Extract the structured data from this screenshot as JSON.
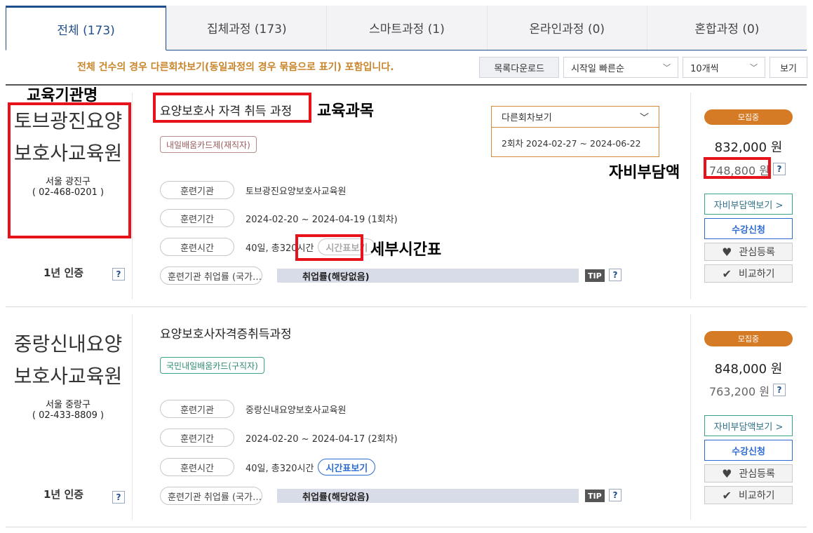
{
  "tabs": [
    {
      "label": "전체 (173)",
      "active": true
    },
    {
      "label": "집체과정 (173)",
      "active": false
    },
    {
      "label": "스마트과정 (1)",
      "active": false
    },
    {
      "label": "온라인과정 (0)",
      "active": false
    },
    {
      "label": "혼합과정 (0)",
      "active": false
    }
  ],
  "notice": "전체 건수의 경우 다른회차보기(동일과정의 경우 묶음으로 표기) 포함입니다.",
  "toolbar": {
    "download_label": "목록다운로드",
    "sort_selected": "시작일 빠른순",
    "count_selected": "10개씩",
    "view_label": "보기"
  },
  "courses": [
    {
      "institution": "토브광진요양보호사교육원",
      "location": "서울 광진구",
      "phone": "( 02-468-0201 )",
      "cert": "1년 인증",
      "title": "요양보호사 자격 취득 과정",
      "tag": "내일배움카드제(재직자)",
      "rows": {
        "org_label": "훈련기관",
        "org_value": "토브광진요양보호사교육원",
        "period_label": "훈련기간",
        "period_value": "2024-02-20 ~ 2024-04-19 (1회차)",
        "hours_label": "훈련시간",
        "hours_value": "40일, 총320시간",
        "timetable_label": "시간표보기",
        "job_label": "훈련기관 취업률 (국가…",
        "job_value": "취업률(해당없음)",
        "tip": "TIP"
      },
      "other_sessions": {
        "header": "다른회차보기",
        "option": "2회차 2024-02-27 ~ 2024-06-22"
      },
      "status": "모집중",
      "price": "832,000 원",
      "self_pay": "748,800 원",
      "actions": {
        "self_pay_view": "자비부담액보기 >",
        "apply": "수강신청",
        "favorite": "관심등록",
        "compare": "비교하기"
      }
    },
    {
      "institution": "중랑신내요양보호사교육원",
      "location": "서울 중랑구",
      "phone": "( 02-433-8809 )",
      "cert": "1년 인증",
      "title": "요양보호사자격증취득과정",
      "tag": "국민내일배움카드(구직자)",
      "rows": {
        "org_label": "훈련기관",
        "org_value": "중랑신내요양보호사교육원",
        "period_label": "훈련기간",
        "period_value": "2024-02-20 ~ 2024-04-17 (2회차)",
        "hours_label": "훈련시간",
        "hours_value": "40일, 총320시간",
        "timetable_label": "시간표보기",
        "job_label": "훈련기관 취업률 (국가…",
        "job_value": "취업률(해당없음)",
        "tip": "TIP"
      },
      "status": "모집중",
      "price": "848,000 원",
      "self_pay": "763,200 원",
      "actions": {
        "self_pay_view": "자비부담액보기 >",
        "apply": "수강신청",
        "favorite": "관심등록",
        "compare": "비교하기"
      }
    }
  ],
  "annotations": {
    "institution_name": "교육기관명",
    "course_subject": "교육과목",
    "self_pay_amount": "자비부담액",
    "detailed_timetable": "세부시간표"
  },
  "help_symbol": "?",
  "icons": {
    "heart": "heart-icon",
    "check": "check-icon",
    "chevron": "chevron-down-icon"
  }
}
